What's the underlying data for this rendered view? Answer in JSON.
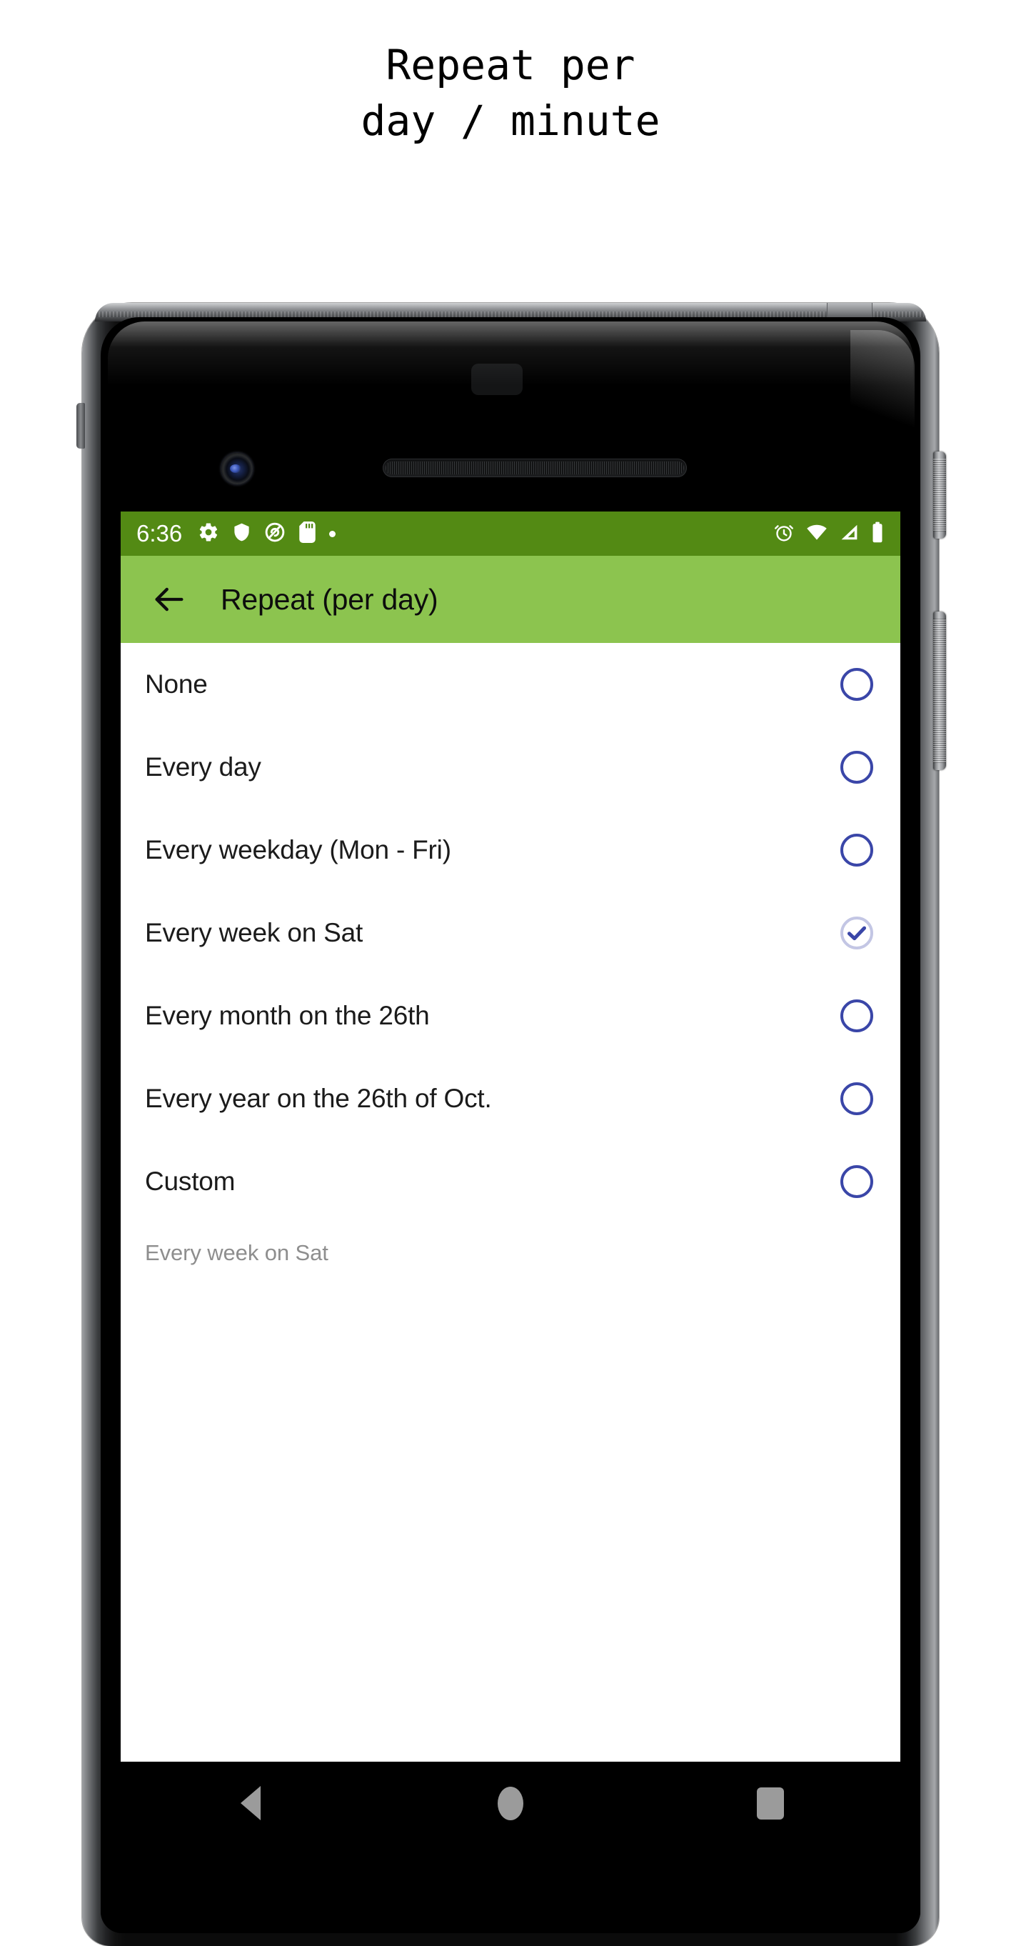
{
  "caption": {
    "line1": "Repeat per",
    "line2": "day / minute"
  },
  "colors": {
    "status_bar_green": "#538a14",
    "app_bar_green": "#8cc44f",
    "radio_blue": "#3a46a8",
    "radio_selected_ring": "#c3c6e4",
    "nav_icon_gray": "#9b9b9b"
  },
  "status_bar": {
    "clock": "6:36",
    "left_icons": [
      "gear-icon",
      "shield-icon",
      "do-not-disturb-icon",
      "sd-card-icon",
      "dot-icon"
    ],
    "right_icons": [
      "alarm-icon",
      "wifi-icon",
      "signal-icon",
      "battery-icon"
    ]
  },
  "app_bar": {
    "back_label": "back-arrow",
    "title": "Repeat (per day)"
  },
  "options": [
    {
      "label": "None",
      "selected": false
    },
    {
      "label": "Every day",
      "selected": false
    },
    {
      "label": "Every weekday (Mon - Fri)",
      "selected": false
    },
    {
      "label": "Every week on Sat",
      "selected": true
    },
    {
      "label": "Every month on the 26th",
      "selected": false
    },
    {
      "label": "Every year on the 26th of Oct.",
      "selected": false
    },
    {
      "label": "Custom",
      "selected": false
    }
  ],
  "footer": {
    "summary": "Every week on Sat"
  },
  "nav_bar": {
    "back": "nav-back",
    "home": "nav-home",
    "recents": "nav-recents"
  }
}
